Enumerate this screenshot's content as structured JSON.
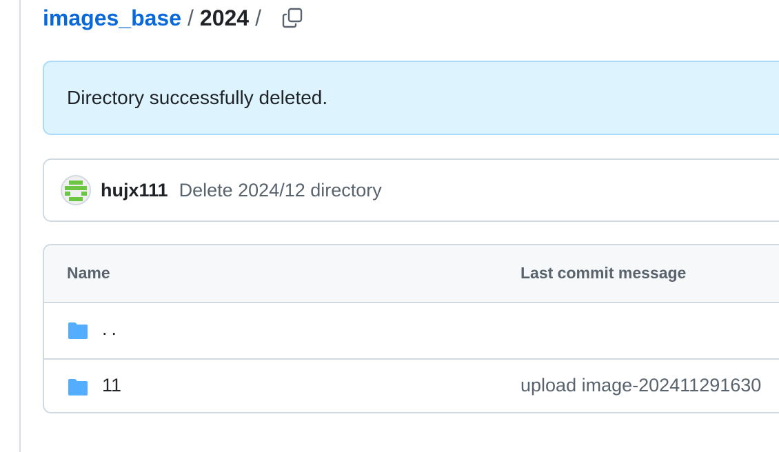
{
  "breadcrumb": {
    "root": "images_base",
    "separator": "/",
    "current": "2024",
    "trailing_separator": "/",
    "copy_icon": "copy-icon"
  },
  "flash": {
    "message": "Directory successfully deleted."
  },
  "commit": {
    "author": "hujx111",
    "message": "Delete 2024/12 directory",
    "avatar_icon": "identicon-avatar"
  },
  "table": {
    "headers": {
      "name": "Name",
      "last_commit_message": "Last commit message"
    },
    "rows": [
      {
        "icon": "folder-icon",
        "name": "..",
        "message": ""
      },
      {
        "icon": "folder-icon",
        "name": "11",
        "message": "upload image-202411291630"
      }
    ]
  },
  "colors": {
    "link": "#0969da",
    "folder": "#54aeff",
    "flash_bg": "#ddf4ff",
    "flash_border": "#a9dbfb",
    "avatar_green": "#6cc644"
  }
}
